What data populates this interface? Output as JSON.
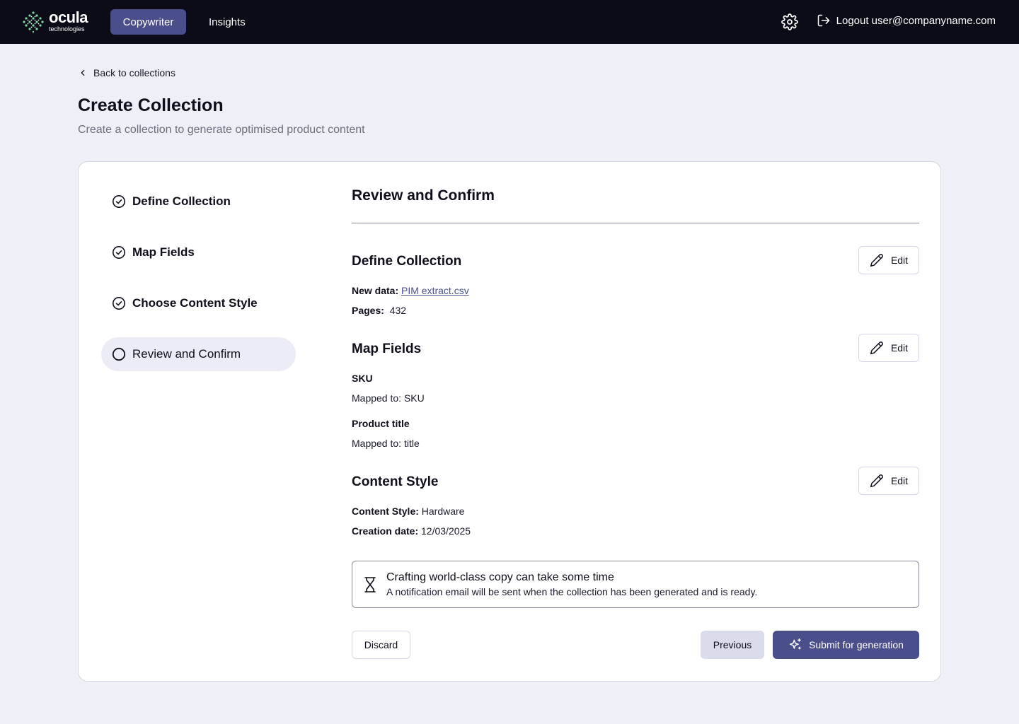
{
  "brand": {
    "name": "ocula",
    "sub": "technologies"
  },
  "nav": {
    "tabs": [
      {
        "label": "Copywriter",
        "active": true
      },
      {
        "label": "Insights",
        "active": false
      }
    ],
    "logout_label": "Logout user@companyname.com"
  },
  "header": {
    "back_label": "Back to collections",
    "title": "Create Collection",
    "subtitle": "Create a collection to generate optimised product content"
  },
  "steps": [
    {
      "label": "Define Collection",
      "state": "done"
    },
    {
      "label": "Map Fields",
      "state": "done"
    },
    {
      "label": "Choose Content Style",
      "state": "done"
    },
    {
      "label": "Review and Confirm",
      "state": "current"
    }
  ],
  "review": {
    "title": "Review and Confirm",
    "edit_label": "Edit",
    "define": {
      "title": "Define Collection",
      "new_data_label": "New data:",
      "new_data_value": "PIM extract.csv",
      "pages_label": "Pages:",
      "pages_value": "432"
    },
    "map": {
      "title": "Map Fields",
      "fields": [
        {
          "name": "SKU",
          "mapped": "Mapped to: SKU"
        },
        {
          "name": "Product title",
          "mapped": "Mapped to: title"
        }
      ]
    },
    "style": {
      "title": "Content Style",
      "style_label": "Content Style:",
      "style_value": "Hardware",
      "date_label": "Creation date:",
      "date_value": "12/03/2025"
    },
    "notice": {
      "title": "Crafting world-class copy can take some time",
      "body": "A notification email will be sent when the collection has been generated and is ready."
    },
    "actions": {
      "discard": "Discard",
      "previous": "Previous",
      "submit": "Submit for generation"
    }
  },
  "colors": {
    "topbar": "#0b0c17",
    "accent": "#4a4f8c",
    "background": "#efeff8",
    "logo_green": "#7ed9a0"
  }
}
